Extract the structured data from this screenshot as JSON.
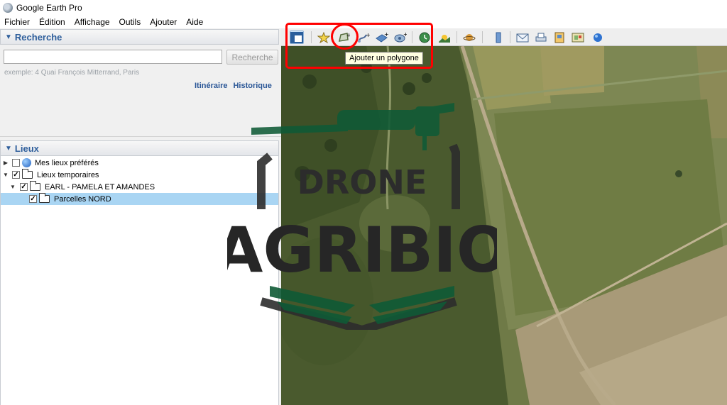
{
  "window": {
    "title": "Google Earth Pro"
  },
  "menu": [
    "Fichier",
    "Édition",
    "Affichage",
    "Outils",
    "Ajouter",
    "Aide"
  ],
  "search": {
    "header": "Recherche",
    "input_value": "",
    "button": "Recherche",
    "example": "exemple:  4 Quai François Mitterrand, Paris",
    "links": [
      "Itinéraire",
      "Historique"
    ]
  },
  "places": {
    "header": "Lieux",
    "items": [
      {
        "label": "Mes lieux préférés",
        "checked": false,
        "icon": "globe-icon"
      },
      {
        "label": "Lieux temporaires",
        "checked": true,
        "icon": "folder-icon"
      },
      {
        "label": "EARL - PAMELA ET AMANDES",
        "checked": true,
        "icon": "folder-icon"
      },
      {
        "label": "Parcelles NORD",
        "checked": true,
        "icon": "folder-icon",
        "selected": true
      }
    ]
  },
  "toolbar": {
    "buttons": [
      "sidebar-toggle-icon",
      "add-placemark-icon",
      "add-polygon-icon",
      "add-path-icon",
      "add-image-overlay-icon",
      "record-tour-icon",
      "historical-imagery-icon",
      "sunlight-icon",
      "planets-icon",
      "ruler-icon",
      "email-icon",
      "print-icon",
      "save-image-icon",
      "view-in-maps-icon",
      "earth-gallery-icon"
    ],
    "tooltip": "Ajouter un polygone"
  },
  "watermark": {
    "line1": "DRONE",
    "line2": "AGRIBIO"
  },
  "colors": {
    "annotation": "#ff0000",
    "logo_green": "#0f5a36",
    "header_blue": "#2f5f9c",
    "selection": "#a9d5f3"
  }
}
